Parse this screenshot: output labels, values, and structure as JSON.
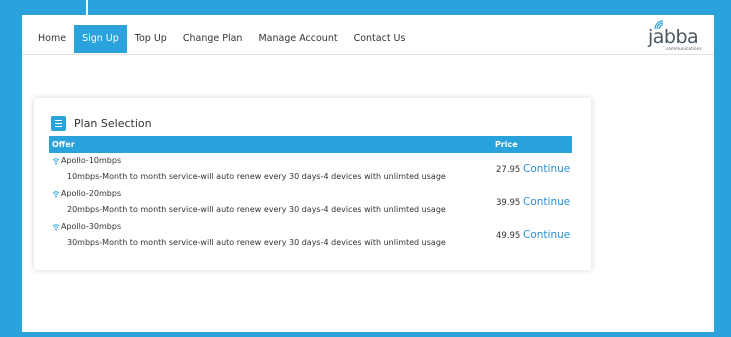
{
  "nav": {
    "items": [
      {
        "label": "Home",
        "active": false
      },
      {
        "label": "Sign Up",
        "active": true
      },
      {
        "label": "Top Up",
        "active": false
      },
      {
        "label": "Change Plan",
        "active": false
      },
      {
        "label": "Manage Account",
        "active": false
      },
      {
        "label": "Contact Us",
        "active": false
      }
    ]
  },
  "logo": {
    "name": "jabba",
    "tagline": "communications"
  },
  "card": {
    "title": "Plan Selection",
    "columns": {
      "offer": "Offer",
      "price": "Price"
    },
    "plans": [
      {
        "name": "Apollo-10mbps",
        "description": "10mbps-Month to month service-will auto renew every 30 days-4 devices with unlimted usage",
        "price": "27.95",
        "action": "Continue"
      },
      {
        "name": "Apollo-20mbps",
        "description": "20mbps-Month to month service-will auto renew every 30 days-4 devices with unlimted usage",
        "price": "39.95",
        "action": "Continue"
      },
      {
        "name": "Apollo-30mbps",
        "description": "30mbps-Month to month service-will auto renew every 30 days-4 devices with unlimted usage",
        "price": "49.95",
        "action": "Continue"
      }
    ]
  },
  "colors": {
    "accent": "#2aa3dc",
    "link": "#2a8fd4",
    "text": "#333333"
  }
}
